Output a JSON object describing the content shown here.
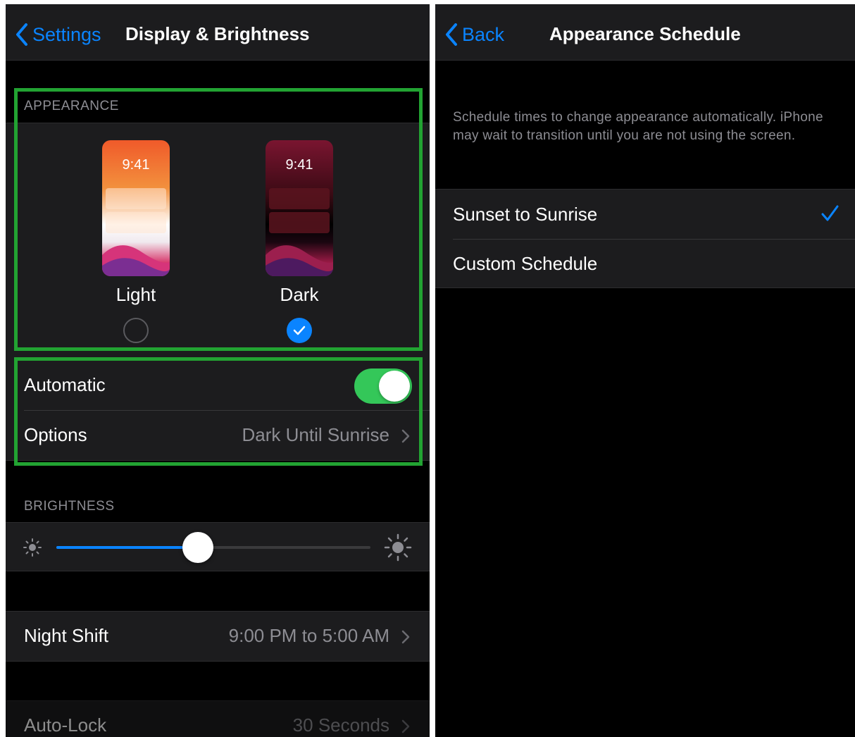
{
  "left_screen": {
    "nav": {
      "back_label": "Settings",
      "title": "Display & Brightness"
    },
    "appearance": {
      "header": "APPEARANCE",
      "light": {
        "time": "9:41",
        "label": "Light",
        "selected": false
      },
      "dark": {
        "time": "9:41",
        "label": "Dark",
        "selected": true
      }
    },
    "automatic": {
      "label": "Automatic",
      "enabled": true
    },
    "options": {
      "label": "Options",
      "value": "Dark Until Sunrise"
    },
    "brightness": {
      "header": "BRIGHTNESS",
      "level": 0.45
    },
    "night_shift": {
      "label": "Night Shift",
      "value": "9:00 PM to 5:00 AM"
    },
    "auto_lock": {
      "label": "Auto-Lock",
      "value": "30 Seconds"
    }
  },
  "right_screen": {
    "nav": {
      "back_label": "Back",
      "title": "Appearance Schedule"
    },
    "description": "Schedule times to change appearance automatically. iPhone may wait to transition until you are not using the screen.",
    "items": [
      {
        "label": "Sunset to Sunrise",
        "checked": true
      },
      {
        "label": "Custom Schedule",
        "checked": false
      }
    ]
  },
  "colors": {
    "accent": "#0a84ff",
    "toggle_on": "#34c759",
    "highlight": "#22a332",
    "cell_bg": "#1c1c1e",
    "secondary_text": "#8d8d93"
  },
  "icons": [
    "chevron-left-icon",
    "chevron-right-icon",
    "checkmark-icon",
    "sun-small-icon",
    "sun-large-icon"
  ]
}
